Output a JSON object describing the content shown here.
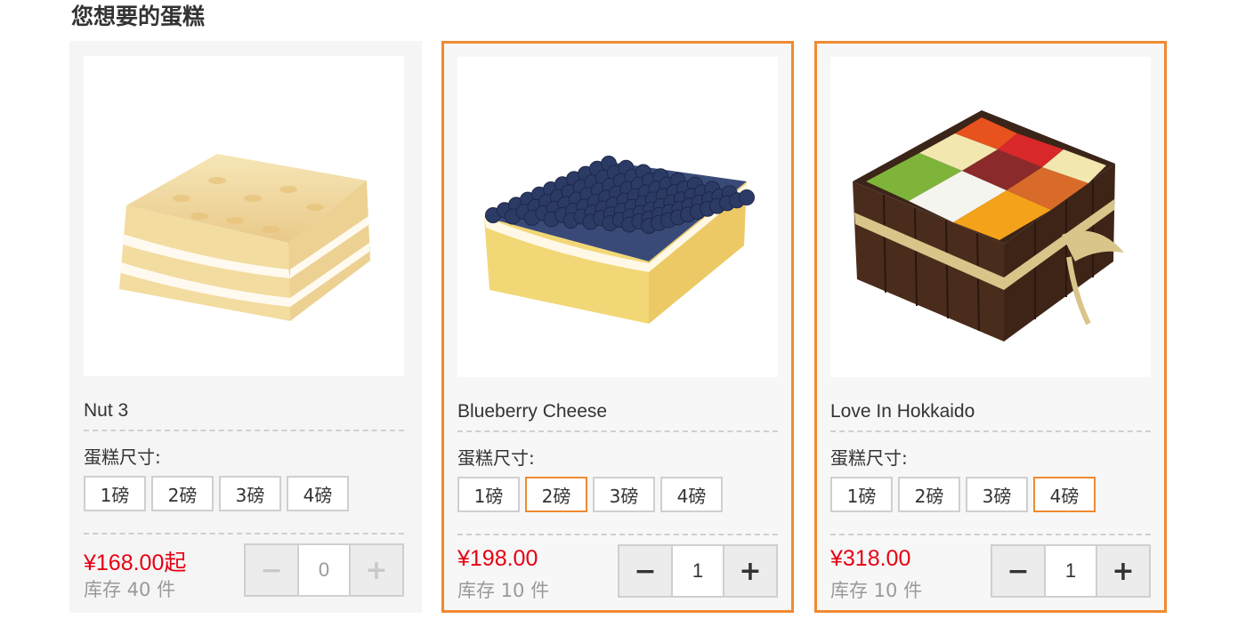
{
  "section_title": "您想要的蛋糕",
  "size_label": "蛋糕尺寸:",
  "colors": {
    "accent": "#f08a30",
    "price": "#e60012"
  },
  "products": [
    {
      "name": "Nut 3",
      "sizes": [
        "1磅",
        "2磅",
        "3磅",
        "4磅"
      ],
      "selected_size": "",
      "price": "¥168.00起",
      "stock": "库存 40 件",
      "quantity": "0",
      "minus": "−",
      "plus": "+",
      "image": "nut-cake-image"
    },
    {
      "name": "Blueberry Cheese",
      "sizes": [
        "1磅",
        "2磅",
        "3磅",
        "4磅"
      ],
      "selected_size": "2磅",
      "price": "¥198.00",
      "stock": "库存 10 件",
      "quantity": "1",
      "minus": "−",
      "plus": "+",
      "image": "blueberry-cheese-cake-image"
    },
    {
      "name": "Love In Hokkaido",
      "sizes": [
        "1磅",
        "2磅",
        "3磅",
        "4磅"
      ],
      "selected_size": "4磅",
      "price": "¥318.00",
      "stock": "库存 10 件",
      "quantity": "1",
      "minus": "−",
      "plus": "+",
      "image": "fruit-box-cake-image"
    }
  ]
}
